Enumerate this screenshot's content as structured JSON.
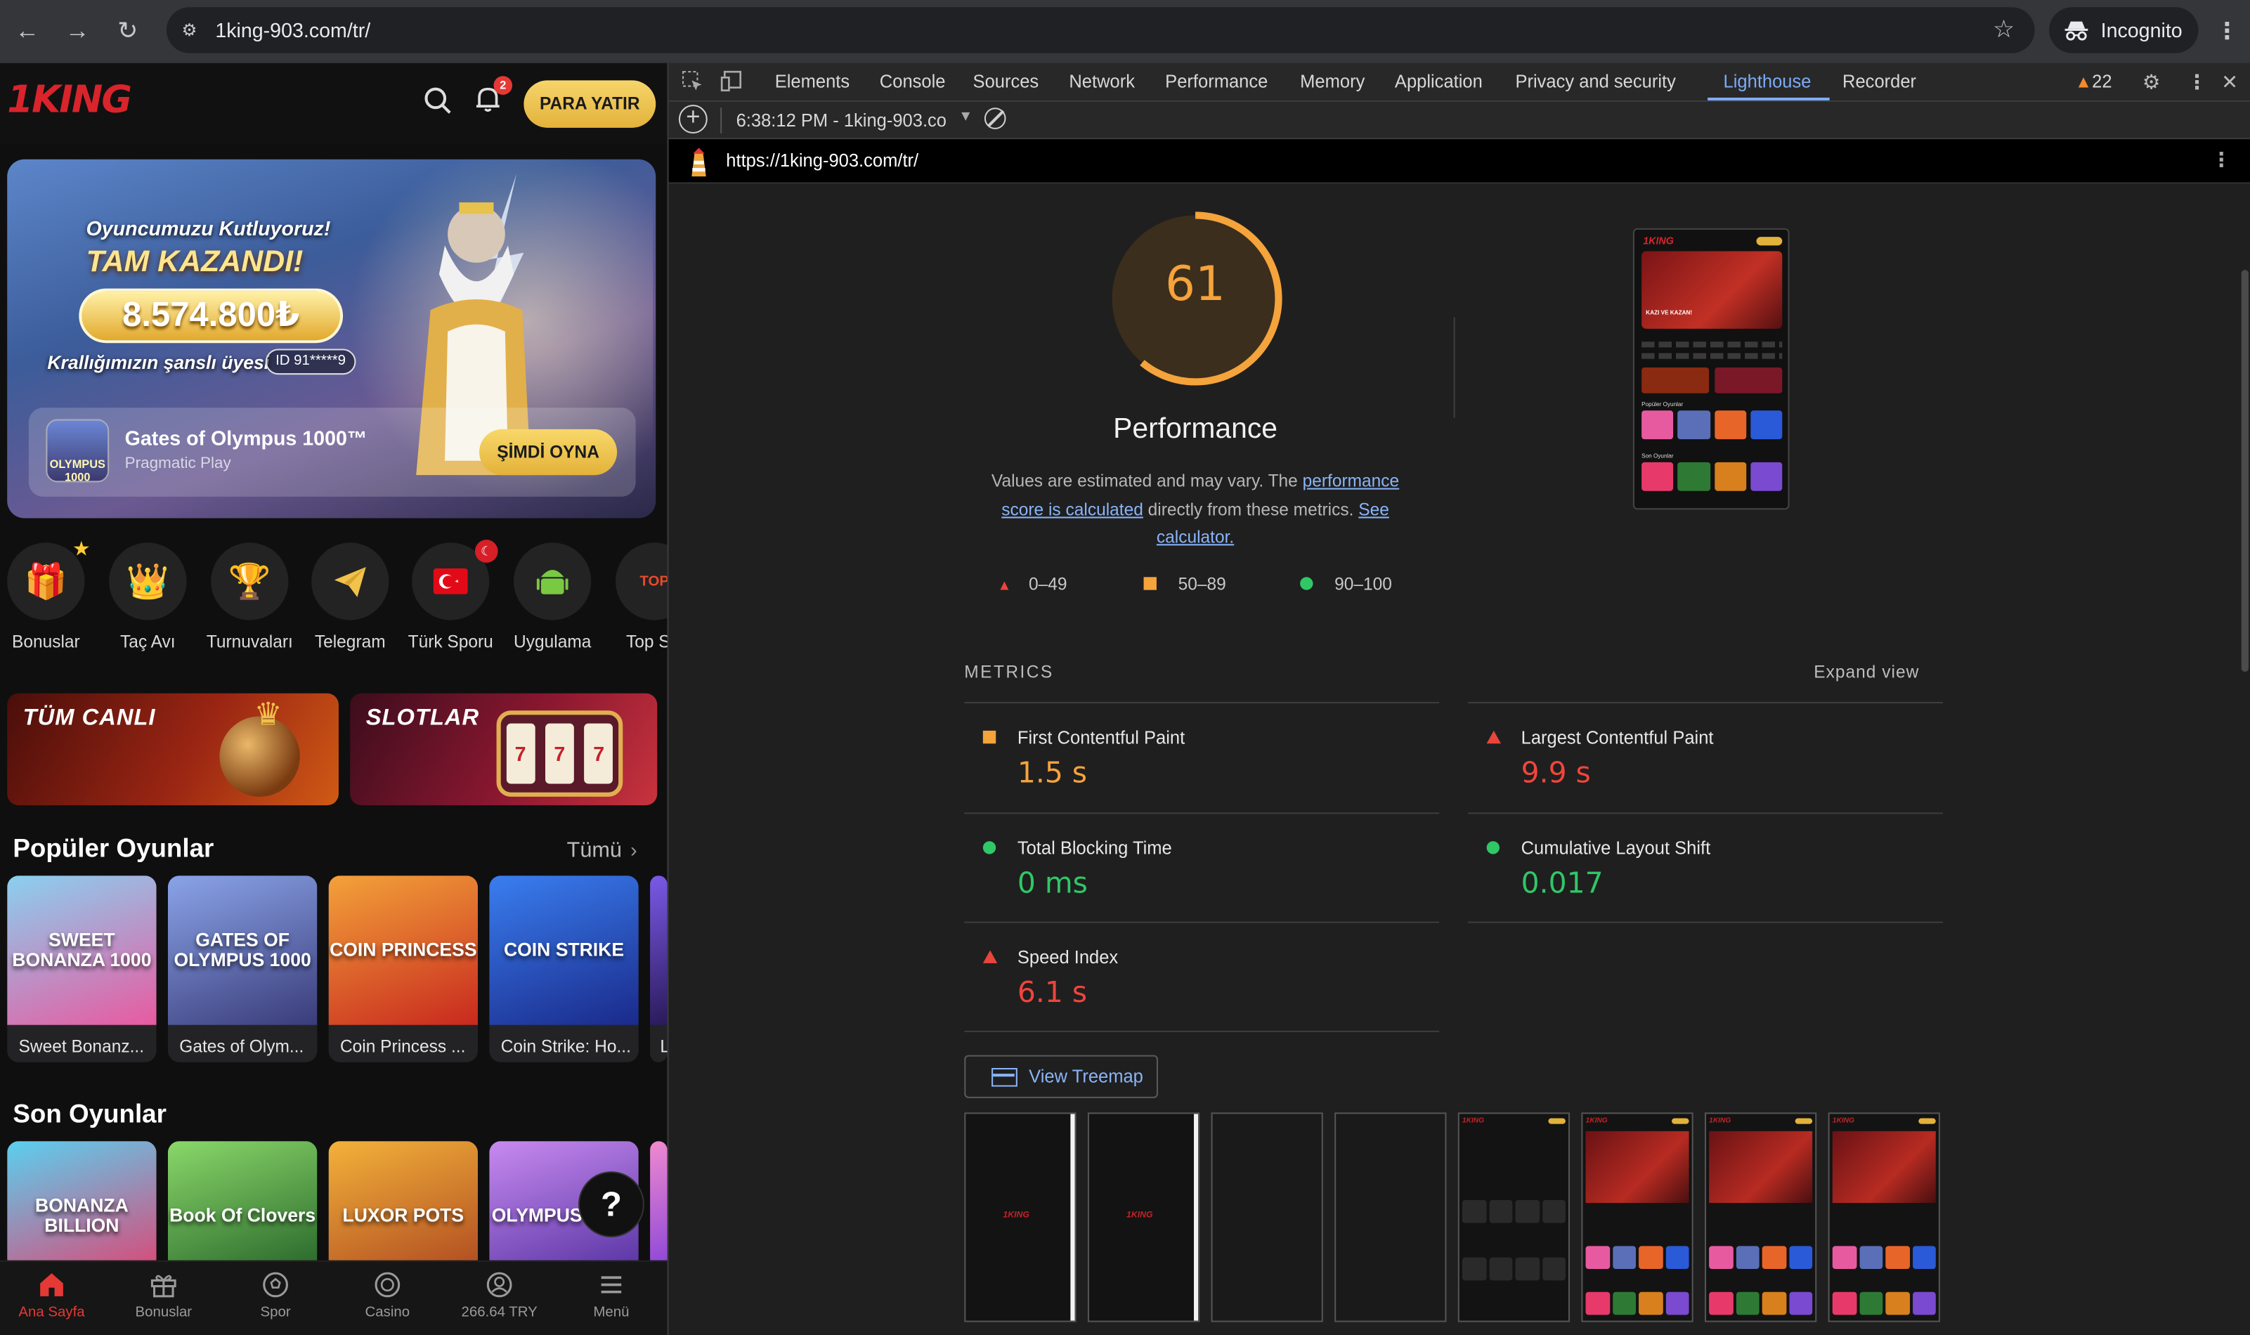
{
  "browser": {
    "url": "1king-903.com/tr/",
    "incognito_label": "Incognito"
  },
  "site": {
    "logo": "1KING",
    "notification_count": "2",
    "deposit_label": "PARA YATIR",
    "hero": {
      "subtitle": "Oyuncumuzu Kutluyoruz!",
      "title": "TAM KAZANDI!",
      "amount": "8.574.800₺",
      "member_text": "Krallığımızın şanslı üyesi",
      "member_id": "ID 91*****9",
      "game_title": "Gates of Olympus 1000™",
      "game_provider": "Pragmatic Play",
      "game_thumb_text": "OLYMPUS 1000",
      "play_label": "ŞİMDİ OYNA"
    },
    "categories": [
      {
        "label": "Bonuslar",
        "icon": "gift-icon"
      },
      {
        "label": "Taç Avı",
        "icon": "crown-icon"
      },
      {
        "label": "Turnuvaları",
        "icon": "trophy-icon"
      },
      {
        "label": "Telegram",
        "icon": "telegram-icon"
      },
      {
        "label": "Türk Sporu",
        "icon": "turkish-flag-icon"
      },
      {
        "label": "Uygulama",
        "icon": "android-icon"
      },
      {
        "label": "Top Slc",
        "icon": "top-slots-icon"
      }
    ],
    "banners": {
      "live": "TÜM CANLI",
      "slots": "SLOTLAR"
    },
    "popular": {
      "title": "Popüler Oyunlar",
      "more": "Tümü",
      "games": [
        {
          "name": "Sweet Bonanz...",
          "art": "SWEET BONANZA 1000",
          "color": "#e85aa0"
        },
        {
          "name": "Gates of Olym...",
          "art": "GATES OF OLYMPUS 1000",
          "color": "#5a6fb8"
        },
        {
          "name": "Coin Princess ...",
          "art": "COIN PRINCESS",
          "color": "#e8652a"
        },
        {
          "name": "Coin Strike: Ho...",
          "art": "COIN STRIKE",
          "color": "#2a5ad8"
        }
      ],
      "partial_name": "L"
    },
    "recent": {
      "title": "Son Oyunlar",
      "games": [
        {
          "art": "BONANZA BILLION",
          "color": "#e83a6a"
        },
        {
          "art": "Book Of Clovers",
          "color": "#2e7a34"
        },
        {
          "art": "LUXOR POTS",
          "color": "#d8801e"
        },
        {
          "art": "OLYMPUS WINS",
          "color": "#7a4ad0"
        }
      ]
    },
    "help_label": "?",
    "bottom_nav": [
      {
        "label": "Ana Sayfa",
        "icon": "home-icon",
        "active": true
      },
      {
        "label": "Bonuslar",
        "icon": "gift-icon",
        "active": false
      },
      {
        "label": "Spor",
        "icon": "soccer-ball-icon",
        "active": false
      },
      {
        "label": "Casino",
        "icon": "casino-chip-icon",
        "active": false
      },
      {
        "label": "266.64 TRY",
        "icon": "user-icon",
        "active": false
      },
      {
        "label": "Menü",
        "icon": "menu-icon",
        "active": false
      }
    ]
  },
  "devtools": {
    "tabs": [
      "Elements",
      "Console",
      "Sources",
      "Network",
      "Performance",
      "Memory",
      "Application",
      "Privacy and security",
      "Lighthouse",
      "Recorder"
    ],
    "active_tab": "Lighthouse",
    "warning_count": "22",
    "report_label": "6:38:12 PM - 1king-903.co",
    "report_url": "https://1king-903.com/tr/"
  },
  "lighthouse": {
    "score": 61,
    "score_color": "#f5a33b",
    "category": "Performance",
    "note_prefix": "Values are estimated and may vary. The ",
    "note_link1": "performance score is calculated",
    "note_mid": " directly from these metrics. ",
    "note_link2": "See calculator.",
    "legend": [
      "0–49",
      "50–89",
      "90–100"
    ],
    "metrics_heading": "METRICS",
    "expand_label": "Expand view",
    "metrics": [
      {
        "name": "First Contentful Paint",
        "value": "1.5 s",
        "rating": "average"
      },
      {
        "name": "Largest Contentful Paint",
        "value": "9.9 s",
        "rating": "fail"
      },
      {
        "name": "Total Blocking Time",
        "value": "0 ms",
        "rating": "pass"
      },
      {
        "name": "Cumulative Layout Shift",
        "value": "0.017",
        "rating": "pass"
      },
      {
        "name": "Speed Index",
        "value": "6.1 s",
        "rating": "fail"
      }
    ],
    "treemap_label": "View Treemap",
    "screenshot_hero_text": "KAZI VE KAZAN!"
  }
}
